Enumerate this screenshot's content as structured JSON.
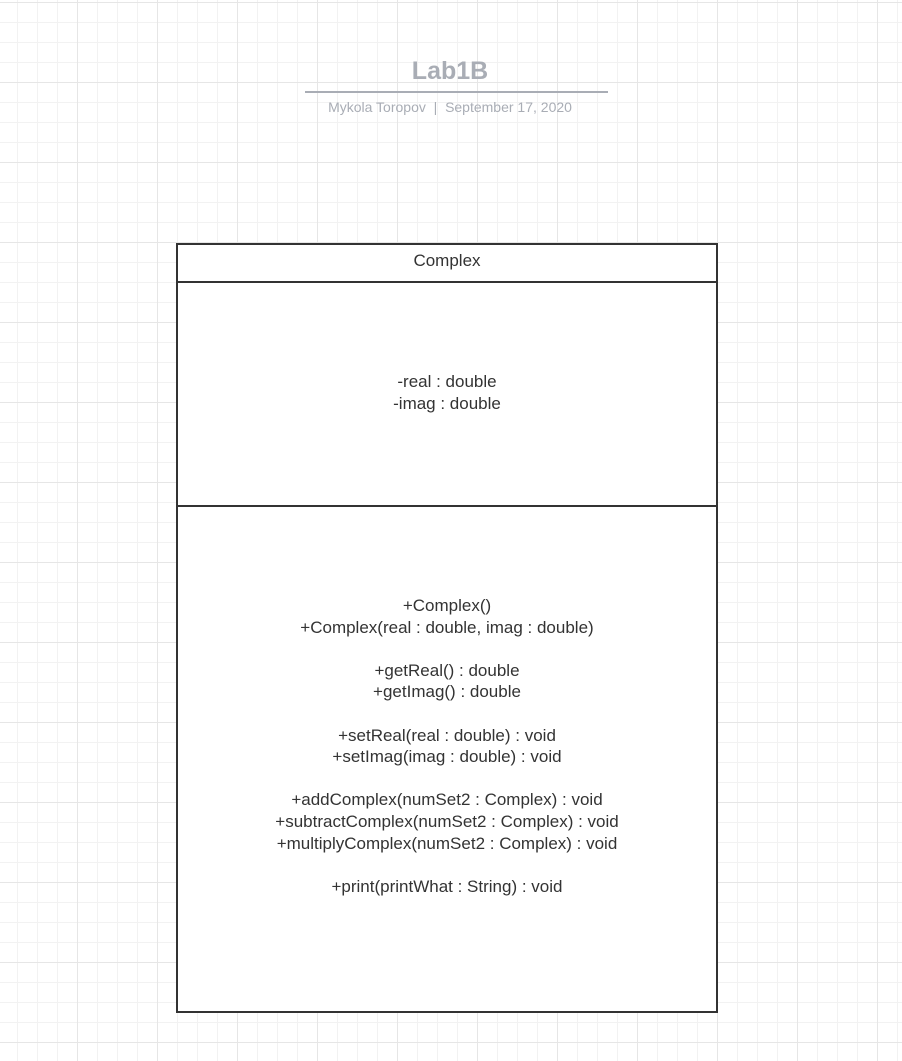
{
  "header": {
    "title": "Lab1B",
    "author": "Mykola Toropov",
    "separator": "|",
    "date": "September 17, 2020"
  },
  "class_box": {
    "name": "Complex",
    "attributes": [
      "-real : double",
      "-imag : double"
    ],
    "operations": [
      "+Complex()",
      "+Complex(real : double, imag : double)",
      "+getReal() : double",
      "+getImag() : double",
      "+setReal(real : double) : void",
      "+setImag(imag : double) : void",
      "+addComplex(numSet2 : Complex) : void",
      "+subtractComplex(numSet2 : Complex) : void",
      "+multiplyComplex(numSet2 : Complex) : void",
      "+print(printWhat : String) : void"
    ]
  }
}
